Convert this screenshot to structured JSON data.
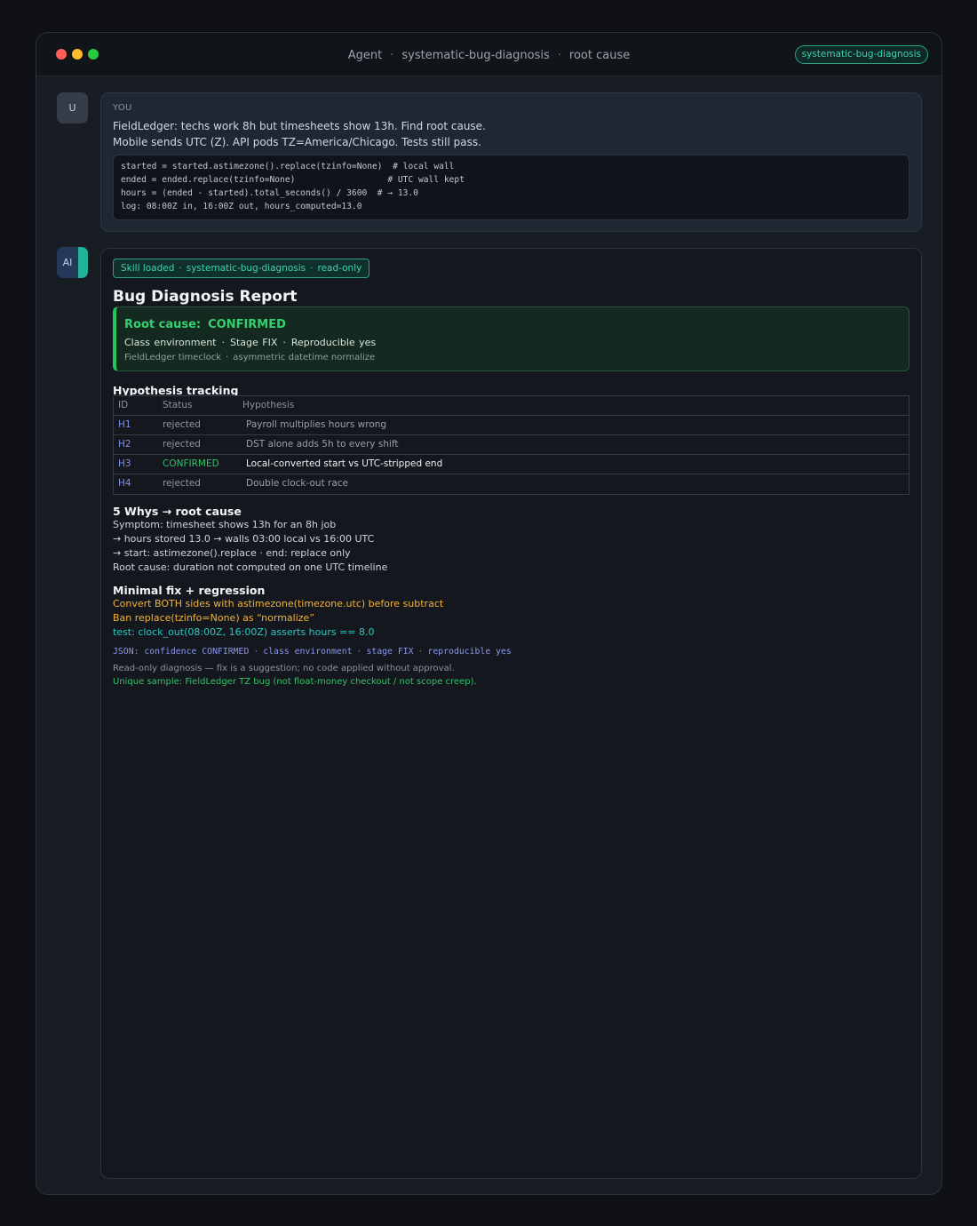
{
  "window": {
    "title_parts": [
      "Agent",
      "systematic-bug-diagnosis",
      "root cause"
    ],
    "skill_pill": "systematic-bug-diagnosis"
  },
  "user": {
    "avatar": "U",
    "label": "YOU",
    "lines": [
      "FieldLedger: techs work 8h but timesheets show 13h. Find root cause.",
      "Mobile sends UTC (Z). API pods TZ=America/Chicago. Tests still pass."
    ],
    "code": [
      "started = started.astimezone().replace(tzinfo=None)  # local wall",
      "ended = ended.replace(tzinfo=None)                  # UTC wall kept",
      "hours = (ended - started).total_seconds() / 3600  # → 13.0",
      "log: 08:00Z in, 16:00Z out, hours_computed=13.0"
    ]
  },
  "ai": {
    "avatar": "AI",
    "skill_badge": [
      "Skill loaded",
      "systematic-bug-diagnosis",
      "read-only"
    ],
    "report_title": "Bug Diagnosis Report",
    "root_cause": {
      "label": "Root cause:",
      "value": "CONFIRMED",
      "meta": [
        "Class  environment",
        "Stage  FIX",
        "Reproducible  yes"
      ],
      "sub": [
        "FieldLedger timeclock",
        "asymmetric datetime normalize"
      ]
    },
    "hypothesis": {
      "heading": "Hypothesis tracking",
      "columns": [
        "ID",
        "Status",
        "Hypothesis"
      ],
      "rows": [
        {
          "id": "H1",
          "status": "rejected",
          "text": "Payroll multiplies hours wrong"
        },
        {
          "id": "H2",
          "status": "rejected",
          "text": "DST alone adds 5h to every shift"
        },
        {
          "id": "H3",
          "status": "CONFIRMED",
          "text": "Local-converted start vs UTC-stripped end"
        },
        {
          "id": "H4",
          "status": "rejected",
          "text": "Double clock-out race"
        }
      ]
    },
    "whys": {
      "heading": "5 Whys → root cause",
      "lines": [
        "Symptom: timesheet shows 13h for an 8h job",
        "→ hours stored 13.0  →  walls 03:00 local vs 16:00 UTC",
        "→ start: astimezone().replace  ·  end: replace only",
        "Root cause: duration not computed on one UTC timeline"
      ]
    },
    "fix": {
      "heading": "Minimal fix + regression",
      "lines": [
        "Convert BOTH sides with astimezone(timezone.utc) before subtract",
        "Ban replace(tzinfo=None) as “normalize”",
        "test: clock_out(08:00Z, 16:00Z) asserts hours == 8.0"
      ]
    },
    "json_parts": [
      "JSON: confidence CONFIRMED",
      "class environment",
      "stage FIX",
      "reproducible yes"
    ],
    "notes": [
      "Read-only diagnosis — fix is a suggestion; no code applied without approval.",
      "Unique sample: FieldLedger TZ bug (not float-money checkout / not scope creep)."
    ]
  }
}
